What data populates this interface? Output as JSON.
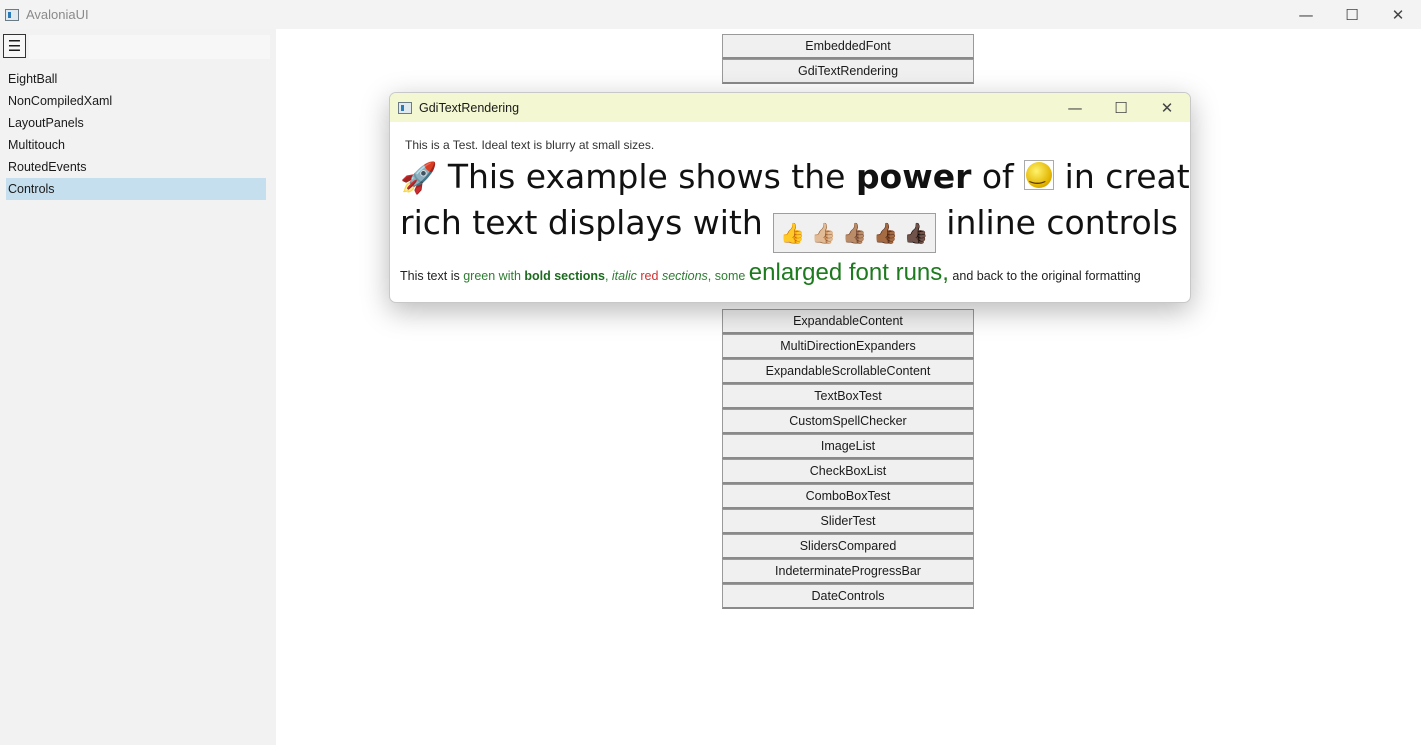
{
  "window": {
    "title": "AvaloniaUI",
    "min_glyph": "—",
    "max_glyph": "☐",
    "close_glyph": "✕"
  },
  "sidebar": {
    "menu_glyph": "☰",
    "items": [
      {
        "label": "EightBall"
      },
      {
        "label": "NonCompiledXaml"
      },
      {
        "label": "LayoutPanels"
      },
      {
        "label": "Multitouch"
      },
      {
        "label": "RoutedEvents"
      },
      {
        "label": "Controls",
        "selected": true
      }
    ]
  },
  "button_list": [
    "EmbeddedFont",
    "GdiTextRendering",
    "ExpandableContent",
    "MultiDirectionExpanders",
    "ExpandableScrollableContent",
    "TextBoxTest",
    "CustomSpellChecker",
    "ImageList",
    "CheckBoxList",
    "ComboBoxTest",
    "SliderTest",
    "SlidersCompared",
    "IndeterminateProgressBar",
    "DateControls"
  ],
  "dialog": {
    "title": "GdiTextRendering",
    "small_text": "This is a Test. Ideal text is blurry at small sizes.",
    "line1": {
      "pre": "This example shows the ",
      "bold": "power",
      "post": " of ",
      "post2": " in creating"
    },
    "line2": {
      "pre": "rich text displays with ",
      "post": " inline controls"
    },
    "rich": {
      "p1": "This text is ",
      "p2": "green with ",
      "p3": "bold sections",
      "p4": ", ",
      "p5": "italic ",
      "p6": "red ",
      "p7": "sections",
      "p8": ", some ",
      "p9": "enlarged font runs",
      "p10": ",",
      "p11": " and back to the original formatting"
    }
  },
  "icons": {
    "rocket": "🚀",
    "thumbs": [
      "👍",
      "👍🏼",
      "👍🏽",
      "👍🏾",
      "👍🏿"
    ],
    "chart": "📈"
  }
}
